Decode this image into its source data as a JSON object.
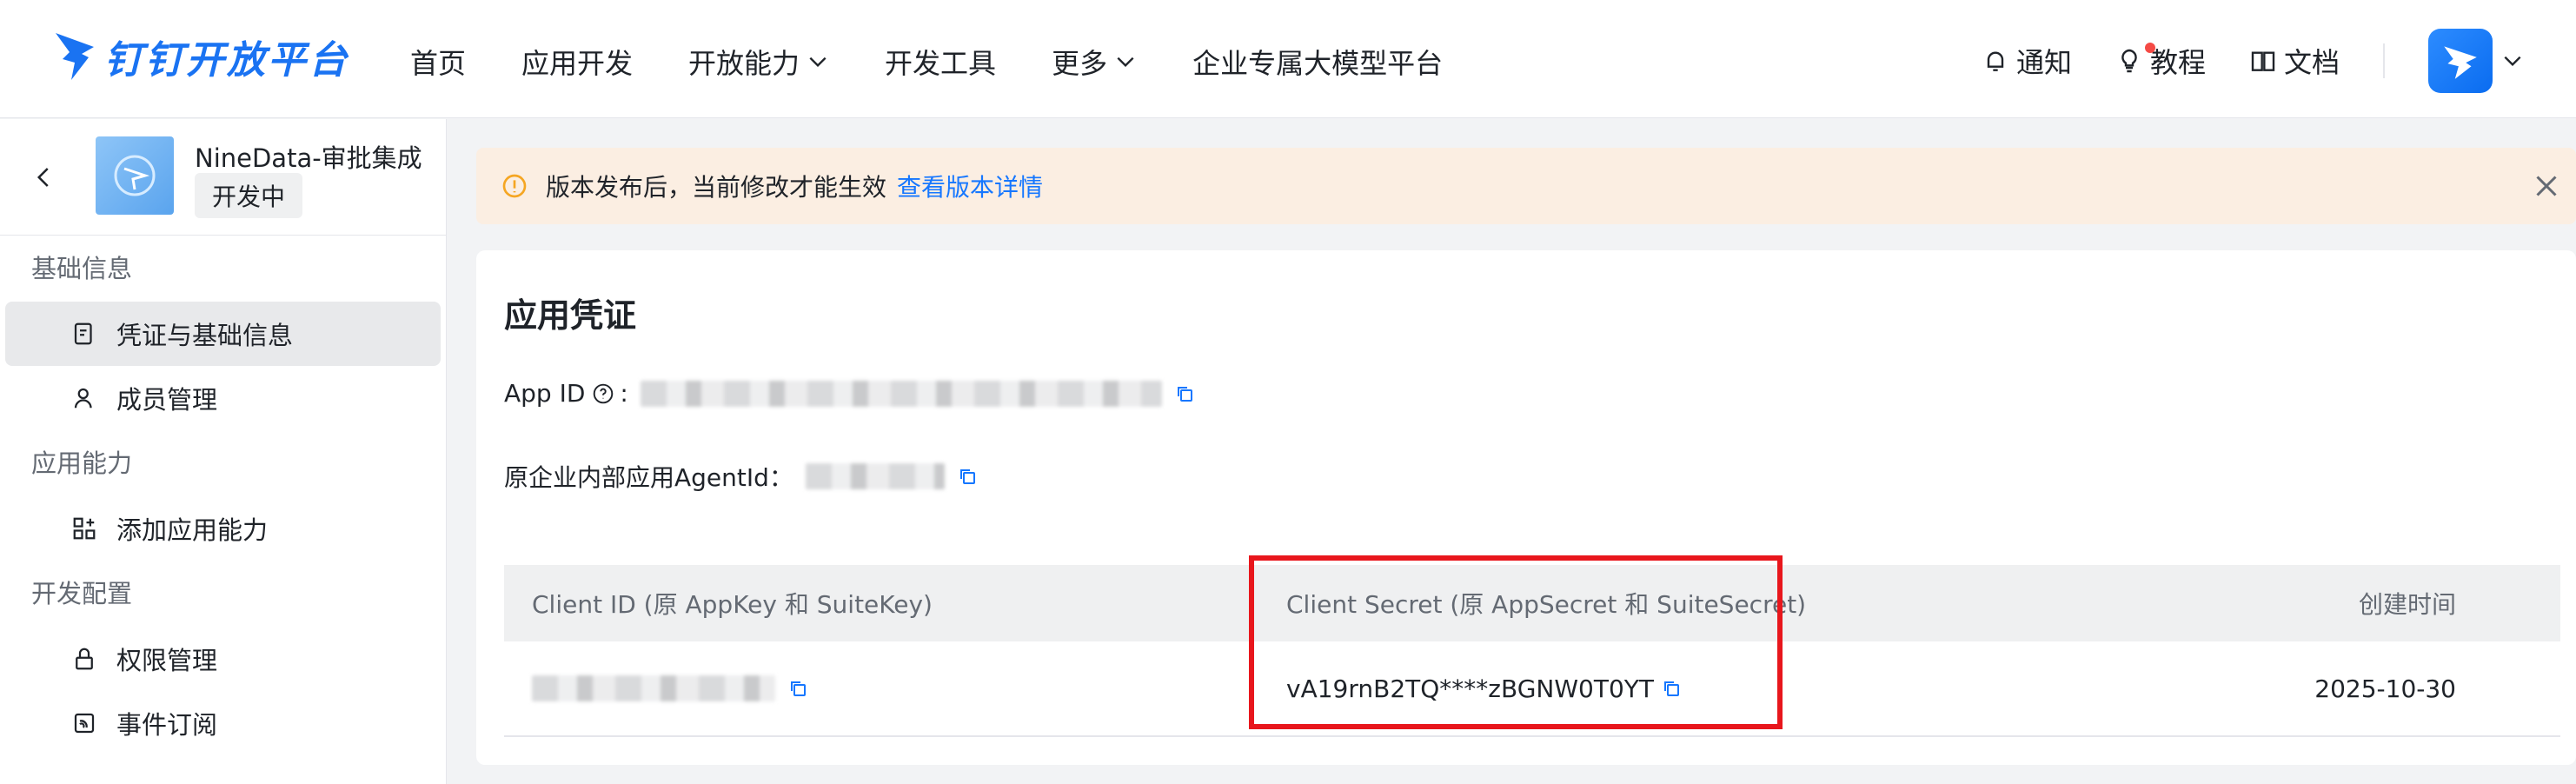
{
  "brand": {
    "name": "钉钉开放平台",
    "color": "#1a73f2"
  },
  "nav": {
    "items": [
      {
        "label": "首页",
        "dropdown": false
      },
      {
        "label": "应用开发",
        "dropdown": false
      },
      {
        "label": "开放能力",
        "dropdown": true
      },
      {
        "label": "开发工具",
        "dropdown": false
      },
      {
        "label": "更多",
        "dropdown": true
      },
      {
        "label": "企业专属大模型平台",
        "dropdown": false
      }
    ],
    "tools": {
      "notify": "通知",
      "tutorial": "教程",
      "docs": "文档"
    }
  },
  "sidebar": {
    "app_name": "NineData-审批集成",
    "app_status": "开发中",
    "groups": [
      {
        "title": "基础信息",
        "items": [
          {
            "label": "凭证与基础信息",
            "icon": "credential-icon",
            "active": true
          },
          {
            "label": "成员管理",
            "icon": "member-icon",
            "active": false
          }
        ]
      },
      {
        "title": "应用能力",
        "items": [
          {
            "label": "添加应用能力",
            "icon": "add-capability-icon",
            "active": false
          }
        ]
      },
      {
        "title": "开发配置",
        "items": [
          {
            "label": "权限管理",
            "icon": "lock-icon",
            "active": false
          },
          {
            "label": "事件订阅",
            "icon": "event-icon",
            "active": false
          }
        ]
      }
    ]
  },
  "notice": {
    "text": "版本发布后，当前修改才能生效",
    "link": "查看版本详情"
  },
  "credentials": {
    "title": "应用凭证",
    "app_id_label": "App ID",
    "agent_id_label": "原企业内部应用AgentId：",
    "table": {
      "headers": [
        "Client ID (原 AppKey 和 SuiteKey)",
        "Client Secret (原 AppSecret 和 SuiteSecret)",
        "创建时间"
      ],
      "row": {
        "client_secret": "vA19rnB2TQ****zBGNW0T0YT",
        "created": "2025-10-30"
      }
    }
  },
  "colors": {
    "accent": "#1677ff",
    "highlight": "#e8161c",
    "notice_bg": "#fbeee2"
  }
}
